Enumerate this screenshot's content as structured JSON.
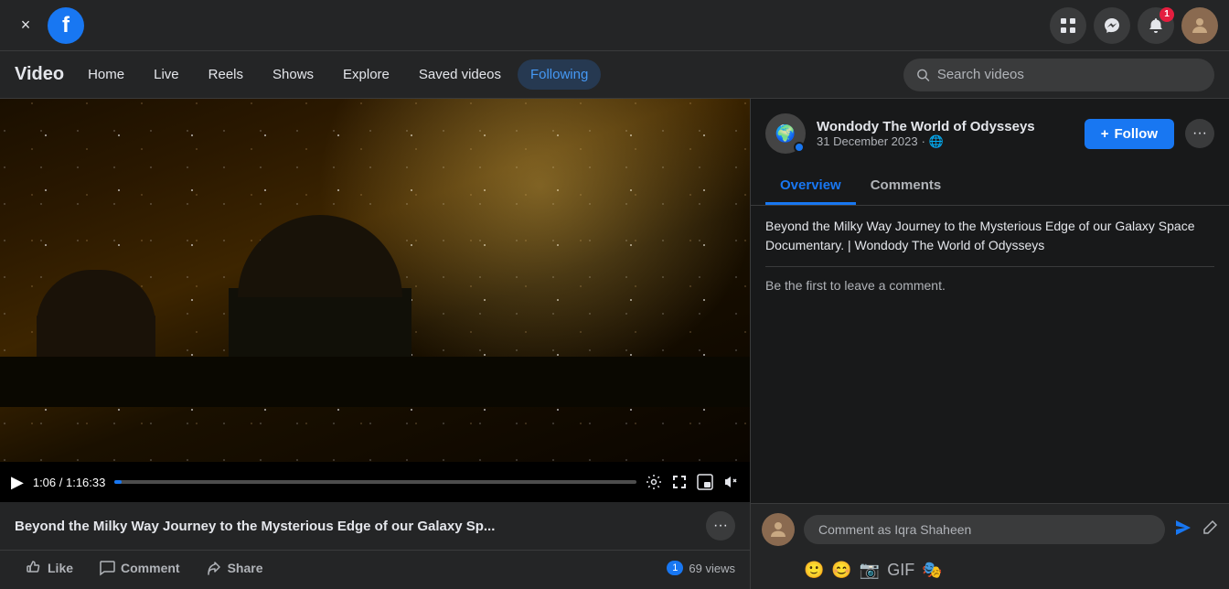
{
  "topNav": {
    "close_label": "×",
    "facebook_logo": "f",
    "grid_icon": "⊞",
    "messenger_icon": "💬",
    "notifications_icon": "🔔",
    "notification_count": "1",
    "avatar_icon": "👤"
  },
  "videoNav": {
    "title": "Video",
    "tabs": [
      {
        "id": "home",
        "label": "Home",
        "active": false
      },
      {
        "id": "live",
        "label": "Live",
        "active": false
      },
      {
        "id": "reels",
        "label": "Reels",
        "active": false
      },
      {
        "id": "shows",
        "label": "Shows",
        "active": false
      },
      {
        "id": "explore",
        "label": "Explore",
        "active": false
      },
      {
        "id": "saved",
        "label": "Saved videos",
        "active": false
      },
      {
        "id": "following",
        "label": "Following",
        "active": false
      }
    ],
    "search_placeholder": "Search videos"
  },
  "videoPlayer": {
    "current_time": "1:06",
    "total_time": "1:16:33",
    "time_display": "1:06 / 1:16:33",
    "progress_percent": 1.35
  },
  "videoInfo": {
    "title": "Beyond the Milky Way Journey to the Mysterious Edge of our Galaxy Sp...",
    "like_count": "1",
    "view_count": "69 views",
    "stats_display": "1 · 69 views",
    "actions": {
      "like": "Like",
      "comment": "Comment",
      "share": "Share"
    }
  },
  "sidebar": {
    "channel": {
      "name": "Wondody The World of Odysseys",
      "post_date": "31 December 2023",
      "globe_icon": "🌐",
      "follow_label": "Follow",
      "follow_icon": "+"
    },
    "tabs": {
      "overview": "Overview",
      "comments": "Comments"
    },
    "description": "Beyond the Milky Way Journey to the Mysterious Edge of our Galaxy Space Documentary. | Wondody The World of Odysseys",
    "comment_prompt": "Be the first to leave a comment.",
    "comment_placeholder": "Comment as Iqra Shaheen",
    "commenter_name": "Iqra Shaheen"
  }
}
